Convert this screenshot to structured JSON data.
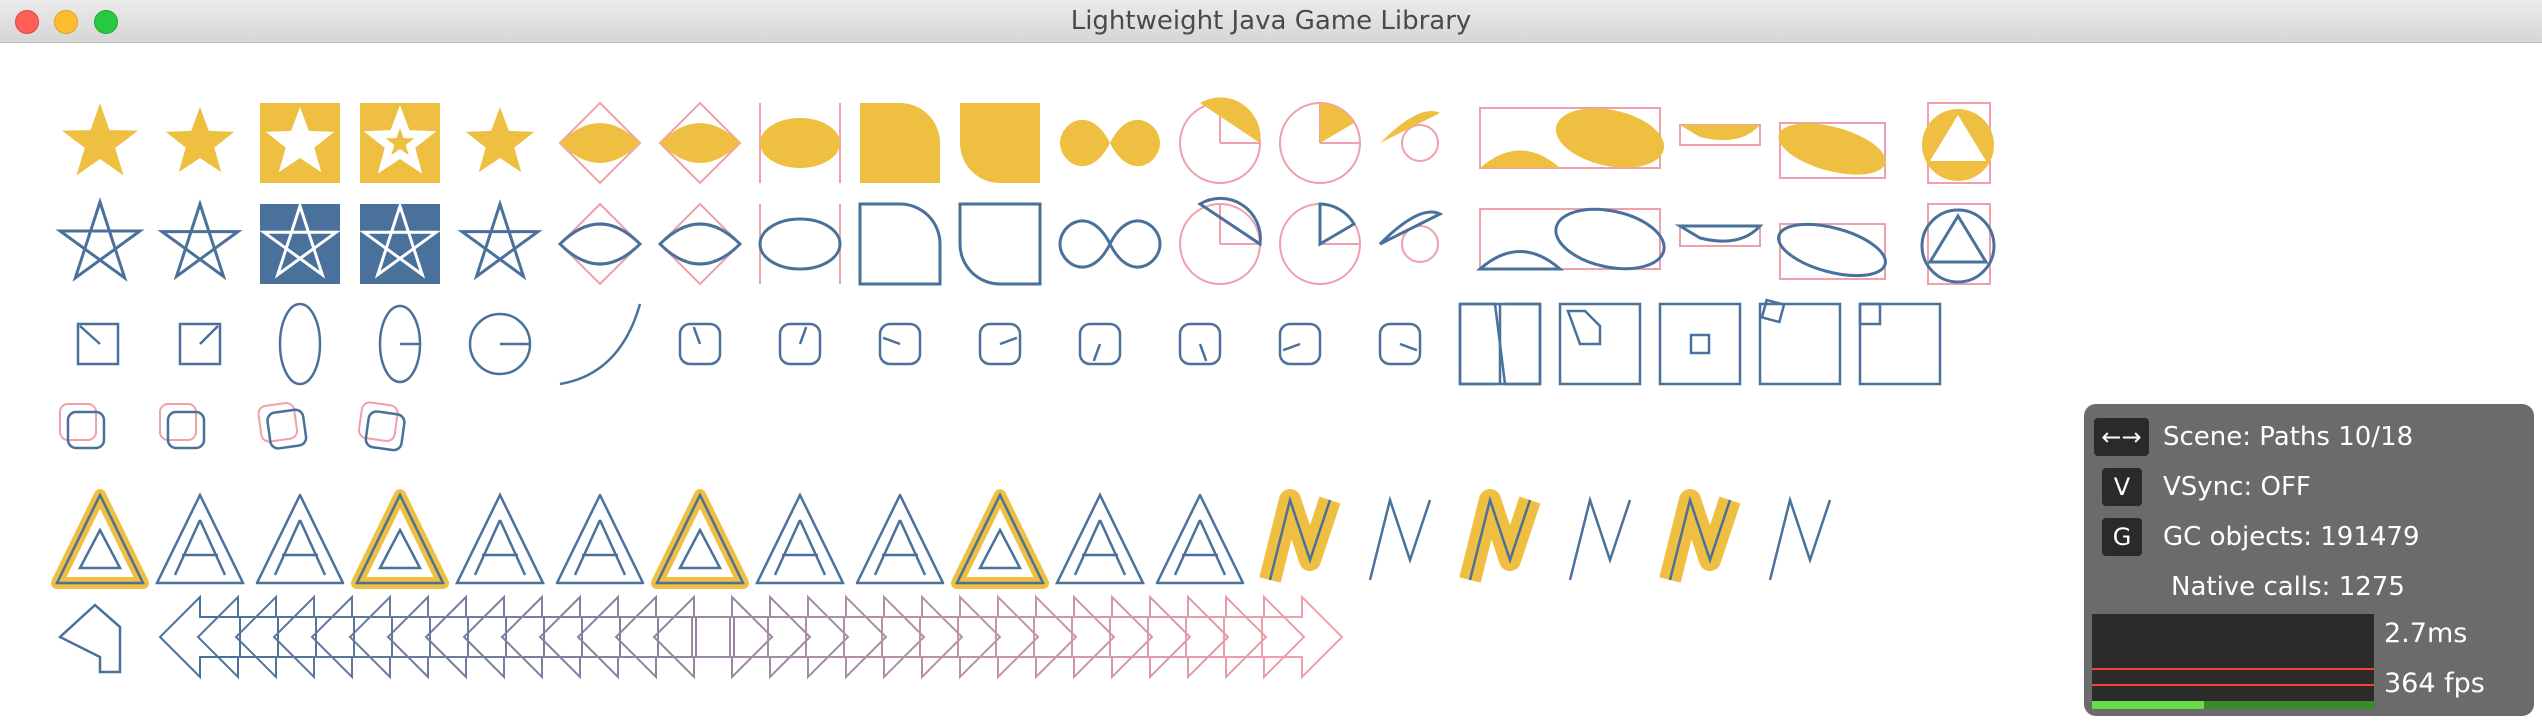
{
  "window": {
    "title": "Lightweight Java Game Library"
  },
  "colors": {
    "fill": "#eebf41",
    "stroke": "#49719b",
    "guide": "#f0a0aa",
    "background": "#ffffff"
  },
  "overlay": {
    "scene_key": "←→",
    "scene_text": "Scene: Paths 10/18",
    "vsync_key": "V",
    "vsync_text": "VSync: OFF",
    "gc_key": "G",
    "gc_text": "GC objects: 191479",
    "native_text": "Native calls: 1275",
    "frame_time": "2.7ms",
    "fps": "364 fps"
  }
}
